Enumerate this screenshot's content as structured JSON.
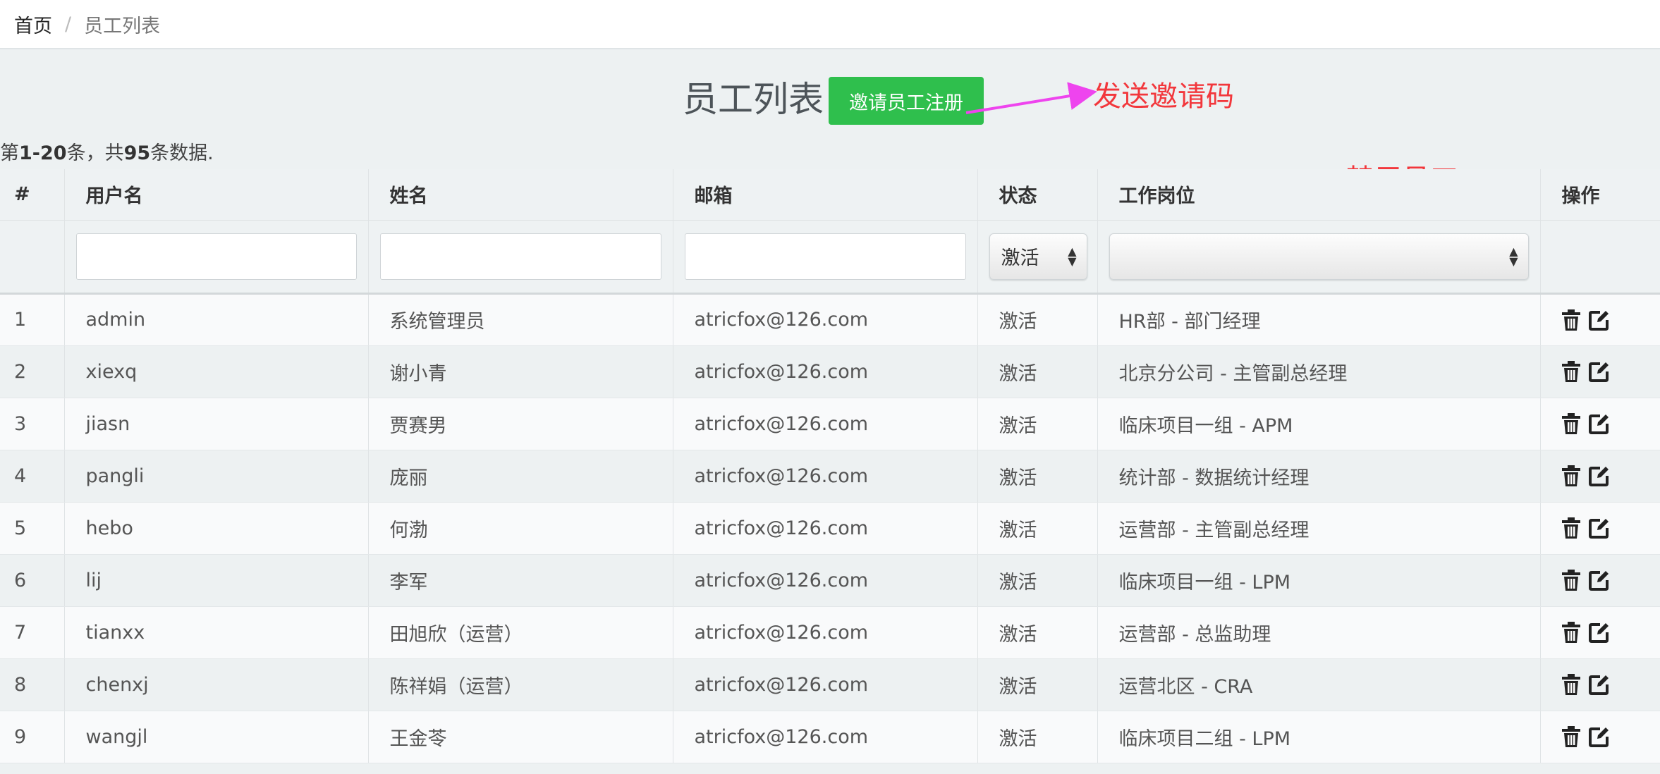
{
  "breadcrumb": {
    "home": "首页",
    "separator": "/",
    "current": "员工列表"
  },
  "page": {
    "title": "员工列表",
    "invite_button": "邀请员工注册"
  },
  "annotations": {
    "send_code": "发送邀请码",
    "disable_employee": "禁用员工",
    "color": "#f2373c",
    "arrow_color": "#ee44ee"
  },
  "summary": {
    "prefix": "第",
    "range": "1-20",
    "middle": "条，共",
    "total": "95",
    "suffix": "条数据."
  },
  "table": {
    "headers": [
      "#",
      "用户名",
      "姓名",
      "邮箱",
      "状态",
      "工作岗位",
      "操作"
    ],
    "filters": {
      "status_selected": "激活",
      "position_selected": ""
    },
    "rows": [
      {
        "no": "1",
        "username": "admin",
        "name": "系统管理员",
        "email": "atricfox@126.com",
        "status": "激活",
        "position": "HR部 - 部门经理"
      },
      {
        "no": "2",
        "username": "xiexq",
        "name": "谢小青",
        "email": "atricfox@126.com",
        "status": "激活",
        "position": "北京分公司 - 主管副总经理"
      },
      {
        "no": "3",
        "username": "jiasn",
        "name": "贾赛男",
        "email": "atricfox@126.com",
        "status": "激活",
        "position": "临床项目一组 - APM"
      },
      {
        "no": "4",
        "username": "pangli",
        "name": "庞丽",
        "email": "atricfox@126.com",
        "status": "激活",
        "position": "统计部 - 数据统计经理"
      },
      {
        "no": "5",
        "username": "hebo",
        "name": "何渤",
        "email": "atricfox@126.com",
        "status": "激活",
        "position": "运营部 - 主管副总经理"
      },
      {
        "no": "6",
        "username": "lij",
        "name": "李军",
        "email": "atricfox@126.com",
        "status": "激活",
        "position": "临床项目一组 - LPM"
      },
      {
        "no": "7",
        "username": "tianxx",
        "name": "田旭欣（运营）",
        "email": "atricfox@126.com",
        "status": "激活",
        "position": "运营部 - 总监助理"
      },
      {
        "no": "8",
        "username": "chenxj",
        "name": "陈祥娟（运营）",
        "email": "atricfox@126.com",
        "status": "激活",
        "position": "运营北区 - CRA"
      },
      {
        "no": "9",
        "username": "wangjl",
        "name": "王金苓",
        "email": "atricfox@126.com",
        "status": "激活",
        "position": "临床项目二组 - LPM"
      }
    ]
  },
  "colors": {
    "background": "#edf1f2",
    "button_green": "#2fbf4d"
  }
}
